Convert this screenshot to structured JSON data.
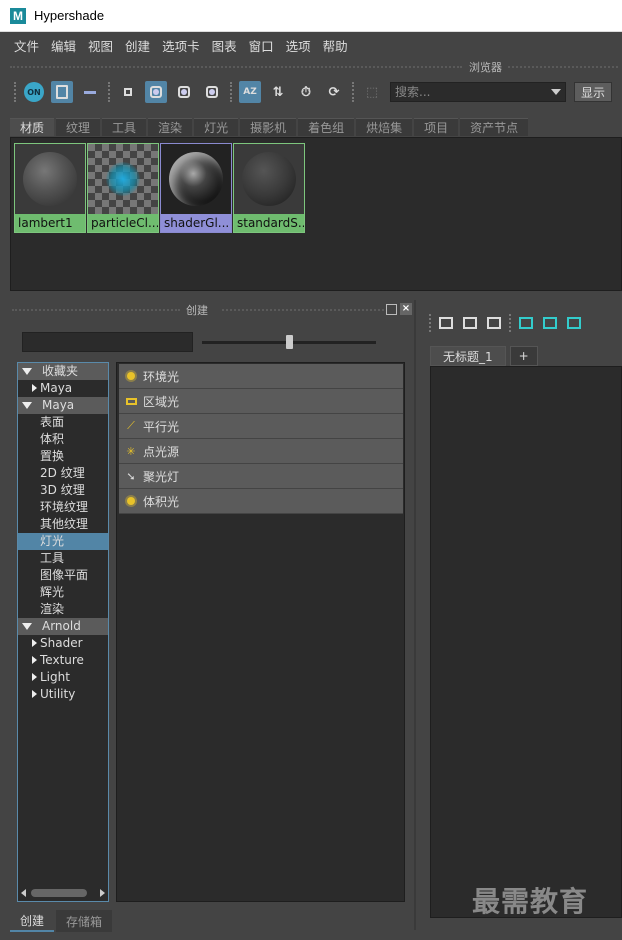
{
  "window": {
    "title": "Hypershade",
    "logo_letter": "M"
  },
  "menubar": [
    "文件",
    "编辑",
    "视图",
    "创建",
    "选项卡",
    "图表",
    "窗口",
    "选项",
    "帮助"
  ],
  "browser": {
    "title": "浏览器",
    "toolbar": {
      "on_label": "ON",
      "search_placeholder": "搜索...",
      "show_label": "显示",
      "sort_label": "AZ"
    },
    "tabs": [
      "材质",
      "纹理",
      "工具",
      "渲染",
      "灯光",
      "摄影机",
      "着色组",
      "烘焙集",
      "项目",
      "资产节点"
    ],
    "active_tab": "材质",
    "materials": [
      {
        "label": "lambert1"
      },
      {
        "label": "particleCl..."
      },
      {
        "label": "shaderGl..."
      },
      {
        "label": "standardS..."
      }
    ]
  },
  "create_panel": {
    "title": "创建",
    "tree": {
      "favorites": "收藏夹",
      "favorites_children": [
        "Maya"
      ],
      "maya": "Maya",
      "maya_children": [
        "表面",
        "体积",
        "置换",
        "2D 纹理",
        "3D 纹理",
        "环境纹理",
        "其他纹理",
        "灯光",
        "工具",
        "图像平面",
        "辉光",
        "渲染"
      ],
      "selected": "灯光",
      "arnold": "Arnold",
      "arnold_children": [
        "Shader",
        "Texture",
        "Light",
        "Utility"
      ]
    },
    "lights": [
      "环境光",
      "区域光",
      "平行光",
      "点光源",
      "聚光灯",
      "体积光"
    ],
    "bottom_tabs": [
      "创建",
      "存储箱"
    ],
    "active_bottom_tab": "创建"
  },
  "graph": {
    "tabs": [
      "无标题_1",
      "+"
    ]
  },
  "watermark": "最需教育"
}
